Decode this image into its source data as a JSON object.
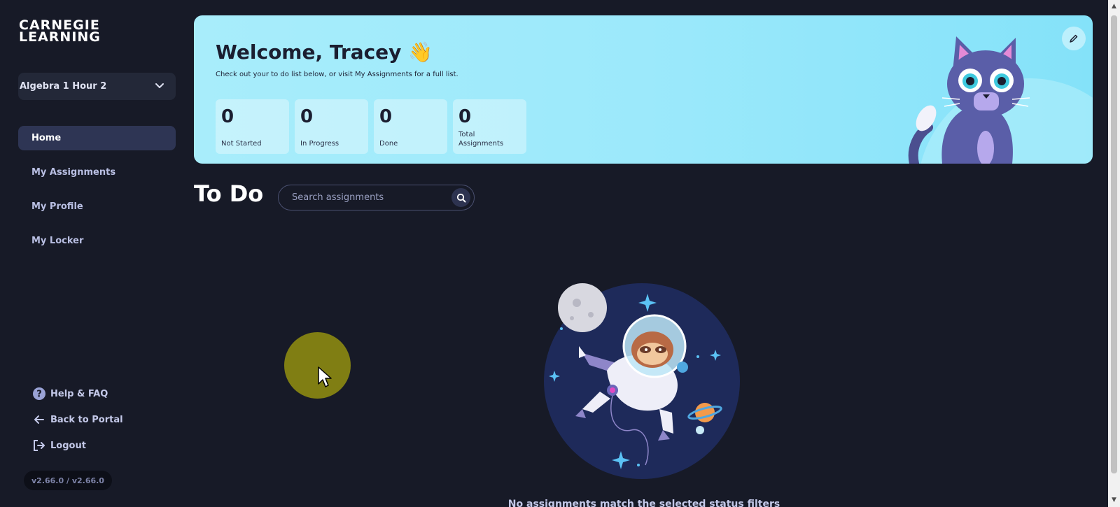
{
  "sidebar": {
    "logo_line1": "CARNEGIE",
    "logo_line2": "LEARNING",
    "class_select": "Algebra 1 Hour 2",
    "nav": [
      {
        "label": "Home",
        "active": true
      },
      {
        "label": "My Assignments"
      },
      {
        "label": "My Profile"
      },
      {
        "label": "My Locker"
      }
    ],
    "bottom": [
      {
        "label": "Help & FAQ",
        "icon": "help-icon"
      },
      {
        "label": "Back to Portal",
        "icon": "arrow-left-icon"
      },
      {
        "label": "Logout",
        "icon": "logout-icon"
      }
    ],
    "version": "v2.66.0 / v2.66.0"
  },
  "banner": {
    "title": "Welcome, Tracey 👋",
    "subtitle": "Check out your to do list below, or visit My Assignments for a full list.",
    "stats": [
      {
        "value": "0",
        "label": "Not Started"
      },
      {
        "value": "0",
        "label": "In Progress"
      },
      {
        "value": "0",
        "label": "Done"
      },
      {
        "value": "0",
        "label": "Total Assignments"
      }
    ],
    "edit_icon": "pencil-icon"
  },
  "todo": {
    "title": "To Do",
    "search_placeholder": "Search assignments",
    "empty_message": "No assignments match the selected status filters"
  },
  "colors": {
    "background": "#171a27",
    "banner": "#9ce9fb",
    "active_nav": "#2e3554"
  }
}
